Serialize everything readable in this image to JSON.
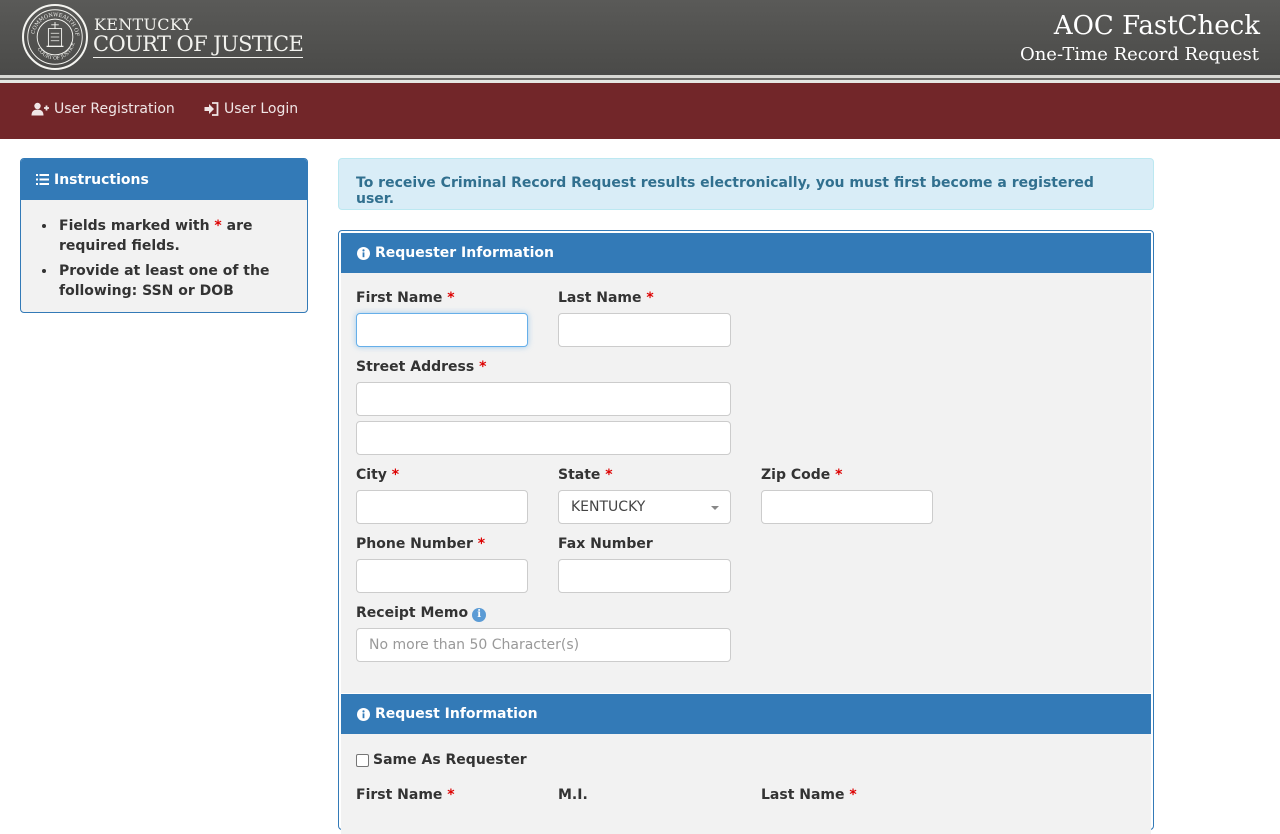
{
  "banner": {
    "brand_line1": "KENTUCKY",
    "brand_line2": "COURT OF JUSTICE",
    "seal_icon": "kentucky-seal",
    "seal_text": "COMMONWEALTH OF KENTUCKY · COURT OF JUSTICE",
    "app_title": "AOC FastCheck",
    "app_subtitle": "One-Time Record Request"
  },
  "nav": {
    "items": [
      {
        "label": "User Registration",
        "icon": "user-plus-icon"
      },
      {
        "label": "User Login",
        "icon": "sign-in-icon"
      }
    ]
  },
  "instructions": {
    "title": "Instructions",
    "icon": "list-icon",
    "item1_pre": "Fields marked with ",
    "item1_star": "*",
    "item1_post": " are required fields.",
    "item2": "Provide at least one of the following: SSN or DOB"
  },
  "alert": {
    "text": "To receive Criminal Record Request results electronically, you must first become a registered user."
  },
  "requester": {
    "title": "Requester Information",
    "icon": "info-circle-icon",
    "first_name": {
      "label": "First Name",
      "value": ""
    },
    "last_name": {
      "label": "Last Name",
      "value": ""
    },
    "street_address": {
      "label": "Street Address",
      "line1": "",
      "line2": ""
    },
    "city": {
      "label": "City",
      "value": ""
    },
    "state": {
      "label": "State",
      "value": "KENTUCKY"
    },
    "zip": {
      "label": "Zip Code",
      "value": ""
    },
    "phone": {
      "label": "Phone Number",
      "value": ""
    },
    "fax": {
      "label": "Fax Number",
      "value": ""
    },
    "memo": {
      "label": "Receipt Memo",
      "placeholder": "No more than 50 Character(s)",
      "info": "i"
    },
    "required_mark": "*"
  },
  "request": {
    "title": "Request Information",
    "icon": "info-circle-icon",
    "same_as_requester": {
      "label": "Same As Requester",
      "checked": false
    },
    "first_name_label": "First Name",
    "mi_label": "M.I.",
    "last_name_label": "Last Name",
    "required_mark": "*"
  },
  "colors": {
    "banner": "#4f4f4d",
    "nav": "#722629",
    "panel_header": "#337ab7",
    "alert_bg": "#d9edf7",
    "alert_text": "#31708f",
    "required": "#dd0000"
  }
}
